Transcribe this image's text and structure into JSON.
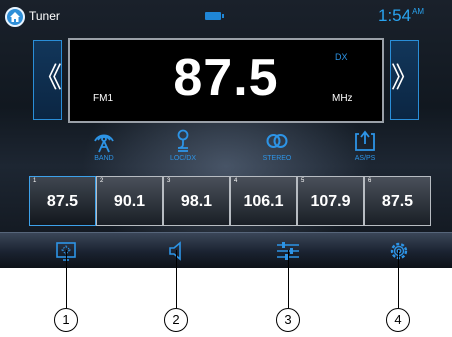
{
  "statusbar": {
    "title": "Tuner",
    "time": "1:54",
    "ampm": "AM"
  },
  "tuner": {
    "frequency": "87.5",
    "band": "FM1",
    "dx": "DX",
    "unit": "MHz"
  },
  "functions": [
    {
      "label": "BAND",
      "icon": "antenna-icon"
    },
    {
      "label": "LOC/DX",
      "icon": "loc-dx-icon"
    },
    {
      "label": "STEREO",
      "icon": "stereo-icon"
    },
    {
      "label": "AS/PS",
      "icon": "auto-store-icon"
    }
  ],
  "presets": [
    {
      "num": "1",
      "value": "87.5",
      "active": true
    },
    {
      "num": "2",
      "value": "90.1"
    },
    {
      "num": "3",
      "value": "98.1"
    },
    {
      "num": "4",
      "value": "106.1"
    },
    {
      "num": "5",
      "value": "107.9"
    },
    {
      "num": "6",
      "value": "87.5"
    }
  ],
  "bottom_bar": [
    {
      "icon": "screen-off-icon"
    },
    {
      "icon": "mute-icon"
    },
    {
      "icon": "equalizer-icon"
    },
    {
      "icon": "settings-icon"
    }
  ],
  "callouts": [
    "1",
    "2",
    "3",
    "4"
  ],
  "colors": {
    "accent": "#2d94e6",
    "clock": "#29a3ef",
    "frequency_panel": "#000000"
  }
}
